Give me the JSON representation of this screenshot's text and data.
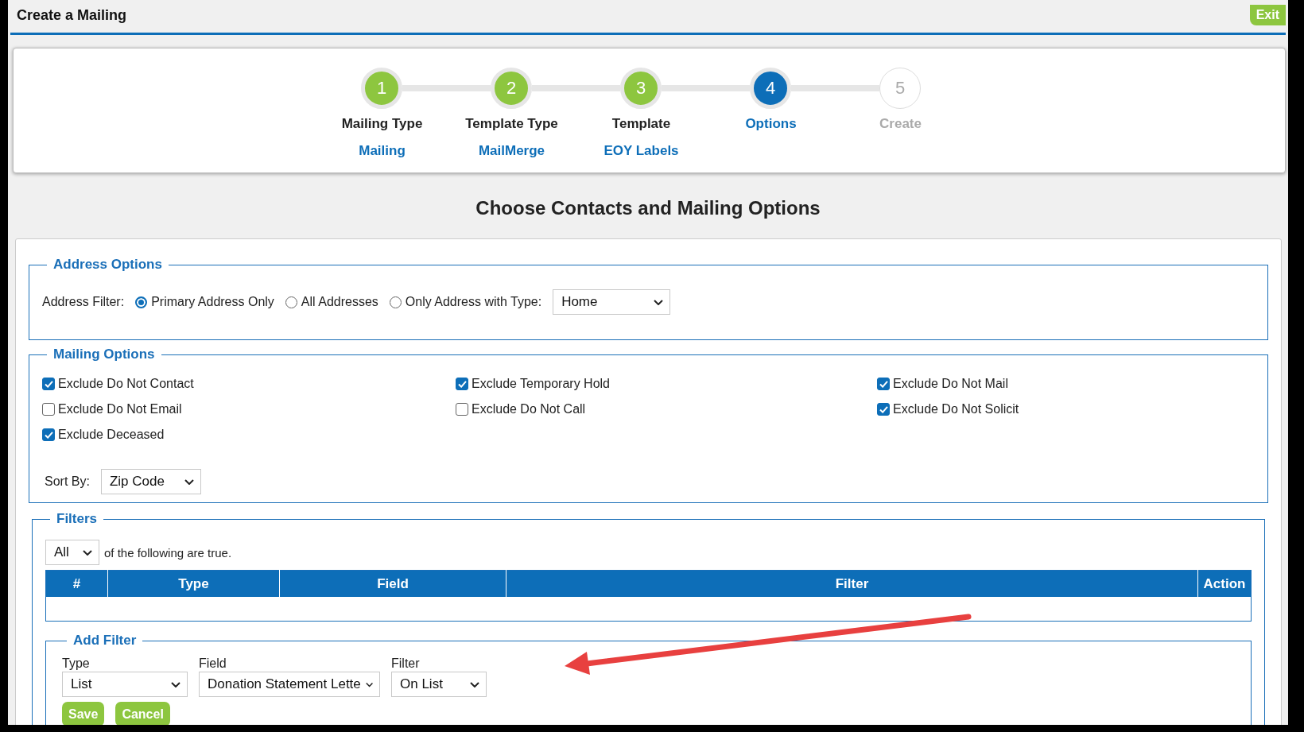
{
  "header": {
    "title": "Create a Mailing",
    "exit_button": "Exit"
  },
  "steps": [
    {
      "number": "1",
      "label": "Mailing Type",
      "value": "Mailing",
      "kind": "done"
    },
    {
      "number": "2",
      "label": "Template Type",
      "value": "MailMerge",
      "kind": "done"
    },
    {
      "number": "3",
      "label": "Template",
      "value": "EOY Labels",
      "kind": "done"
    },
    {
      "number": "4",
      "label": "Options",
      "kind": "current"
    },
    {
      "number": "5",
      "label": "Create",
      "kind": "upcoming"
    }
  ],
  "heading": "Choose Contacts and Mailing Options",
  "address_options": {
    "legend": "Address Options",
    "label": "Address Filter:",
    "radios": [
      {
        "label": "Primary Address Only",
        "selected": true
      },
      {
        "label": "All Addresses",
        "selected": false
      },
      {
        "label": "Only Address with Type:",
        "selected": false
      }
    ],
    "type_select": "Home"
  },
  "mailing_options": {
    "legend": "Mailing Options",
    "checkboxes": [
      {
        "label": "Exclude Do Not Contact",
        "checked": true
      },
      {
        "label": "Exclude Temporary Hold",
        "checked": true
      },
      {
        "label": "Exclude Do Not Mail",
        "checked": true
      },
      {
        "label": "Exclude Do Not Email",
        "checked": false
      },
      {
        "label": "Exclude Do Not Call",
        "checked": false
      },
      {
        "label": "Exclude Do Not Solicit",
        "checked": true
      },
      {
        "label": "Exclude Deceased",
        "checked": true
      }
    ],
    "sort_label": "Sort By:",
    "sort_select": "Zip Code"
  },
  "filters": {
    "legend": "Filters",
    "match_select": "All",
    "match_text": "of the following are true.",
    "table": {
      "columns": [
        "#",
        "Type",
        "Field",
        "Filter",
        "Action"
      ]
    },
    "add_filter": {
      "legend": "Add Filter",
      "fields": [
        {
          "label": "Type",
          "value": "List"
        },
        {
          "label": "Field",
          "value": "Donation Statement Lette"
        },
        {
          "label": "Filter",
          "value": "On List"
        }
      ],
      "buttons": [
        "Save",
        "Cancel"
      ]
    }
  }
}
